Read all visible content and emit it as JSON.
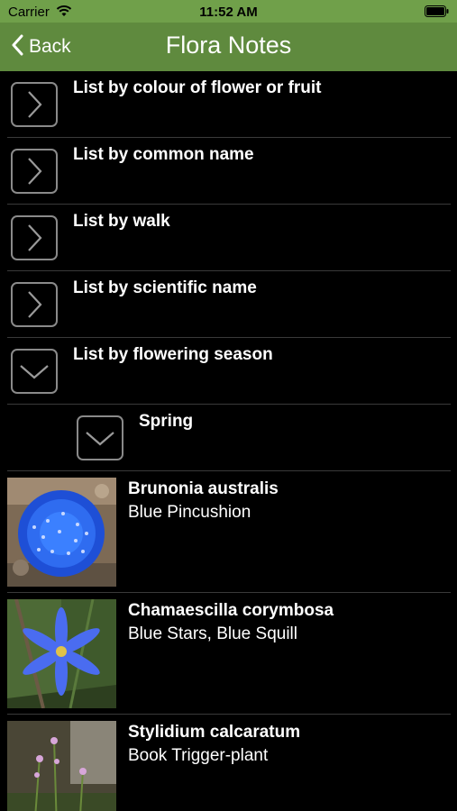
{
  "status_bar": {
    "carrier": "Carrier",
    "time": "11:52 AM"
  },
  "nav": {
    "back_label": "Back",
    "title": "Flora Notes"
  },
  "menu_items": [
    {
      "label": "List by colour of flower or fruit",
      "state": "collapsed"
    },
    {
      "label": "List by common name",
      "state": "collapsed"
    },
    {
      "label": "List by walk",
      "state": "collapsed"
    },
    {
      "label": "List by scientific name",
      "state": "collapsed"
    },
    {
      "label": "List by flowering season",
      "state": "expanded"
    }
  ],
  "season": {
    "label": "Spring",
    "state": "expanded"
  },
  "plants": [
    {
      "scientific": "Brunonia australis",
      "common": "Blue Pincushion",
      "image": "blue-pincushion-photo"
    },
    {
      "scientific": "Chamaescilla corymbosa",
      "common": "Blue Stars, Blue Squill",
      "image": "blue-stars-photo"
    },
    {
      "scientific": "Stylidium calcaratum",
      "common": "Book Trigger-plant",
      "image": "trigger-plant-photo"
    }
  ],
  "colors": {
    "status_bar": "#70a04a",
    "nav_bar": "#5f8a3e",
    "background": "#000000",
    "button_border": "#8a8a8a"
  }
}
